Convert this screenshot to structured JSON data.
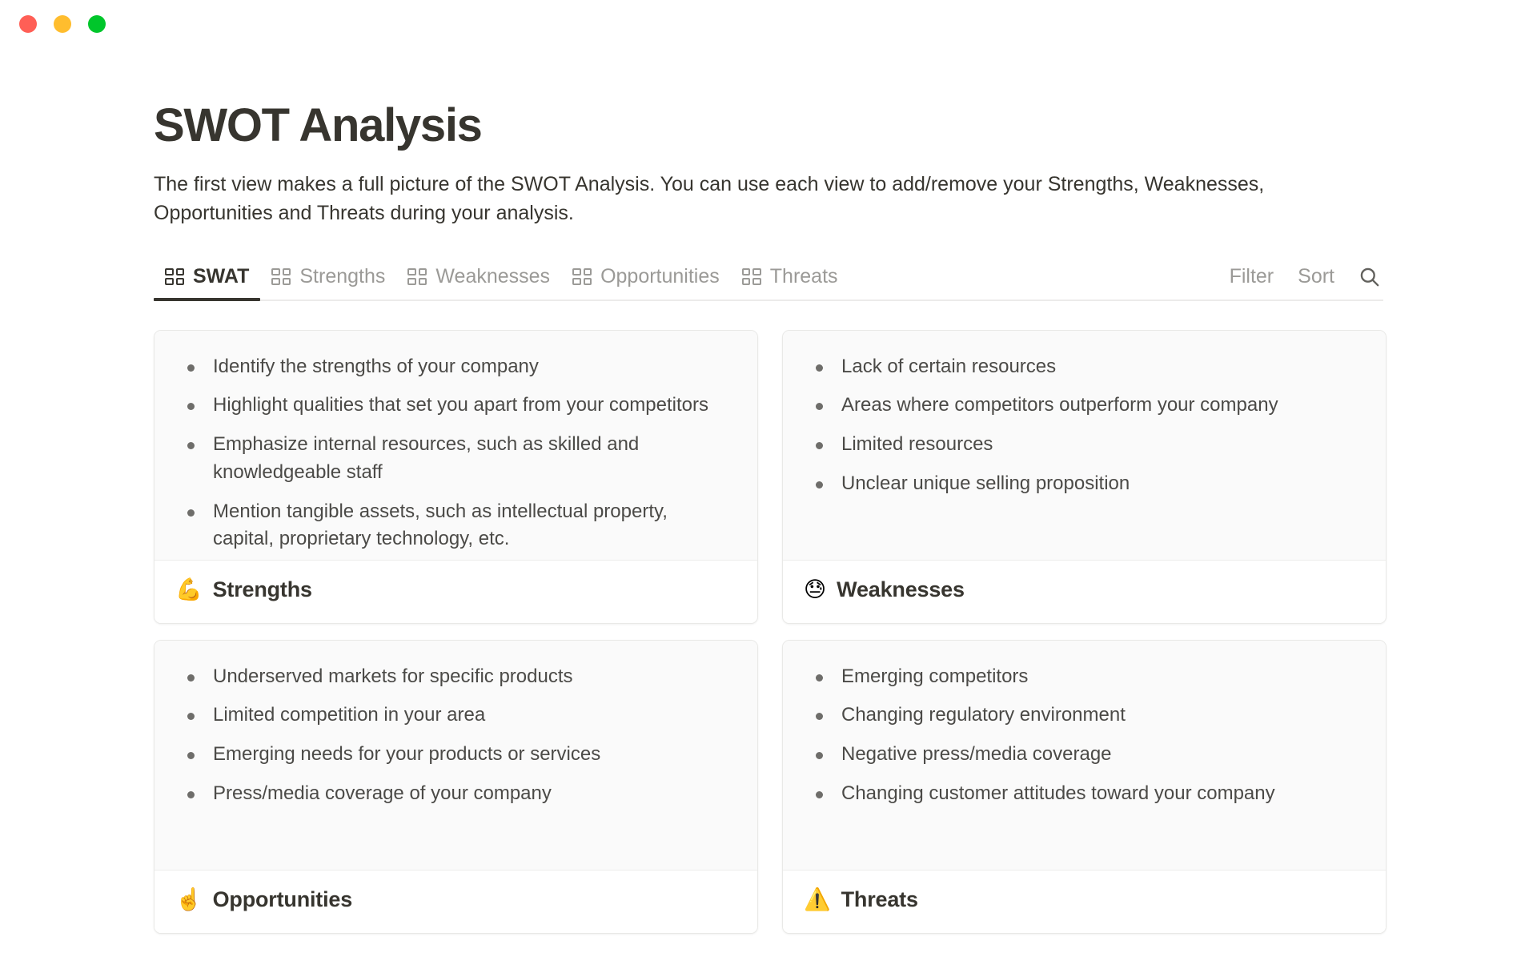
{
  "window": {
    "controls": [
      {
        "name": "close",
        "color": "#ff5f56"
      },
      {
        "name": "minimize",
        "color": "#ffbd2e"
      },
      {
        "name": "maximize",
        "color": "#00c62b"
      }
    ]
  },
  "header": {
    "title": "SWOT Analysis",
    "description": "The first view makes a full picture of the SWOT Analysis. You can use each view to add/remove your Strengths, Weaknesses, Opportunities and Threats during your analysis."
  },
  "tabs": [
    {
      "label": "SWAT",
      "icon": "gallery-view-icon",
      "active": true
    },
    {
      "label": "Strengths",
      "icon": "gallery-view-icon",
      "active": false
    },
    {
      "label": "Weaknesses",
      "icon": "gallery-view-icon",
      "active": false
    },
    {
      "label": "Opportunities",
      "icon": "gallery-view-icon",
      "active": false
    },
    {
      "label": "Threats",
      "icon": "gallery-view-icon",
      "active": false
    }
  ],
  "tab_actions": {
    "filter_label": "Filter",
    "sort_label": "Sort",
    "search_icon": "search-icon"
  },
  "cards": [
    {
      "title": "Strengths",
      "emoji": "💪",
      "emoji_name": "flexed-biceps-emoji",
      "items": [
        "Identify the strengths of your company",
        "Highlight qualities that set you apart from your competitors",
        "Emphasize internal resources, such as skilled and knowledgeable staff",
        "Mention tangible assets, such as intellectual property, capital, proprietary technology, etc."
      ]
    },
    {
      "title": "Weaknesses",
      "emoji": "😓",
      "emoji_name": "downcast-face-with-sweat-emoji",
      "items": [
        "Lack of certain resources",
        "Areas where competitors outperform your company",
        "Limited resources",
        "Unclear unique selling proposition"
      ]
    },
    {
      "title": "Opportunities",
      "emoji": "☝️",
      "emoji_name": "index-pointing-up-emoji",
      "items": [
        "Underserved markets for specific products",
        "Limited competition in your area",
        "Emerging needs for your products or services",
        "Press/media coverage of your company"
      ]
    },
    {
      "title": "Threats",
      "emoji": "⚠️",
      "emoji_name": "warning-emoji",
      "items": [
        "Emerging competitors",
        "Changing regulatory environment",
        "Negative press/media coverage",
        "Changing customer attitudes toward your company"
      ]
    }
  ],
  "colors": {
    "text_primary": "#37352f",
    "text_secondary": "#9b9a97",
    "card_body_bg": "#fafafa",
    "border": "#e9e9e7",
    "active_underline": "#37352f"
  }
}
